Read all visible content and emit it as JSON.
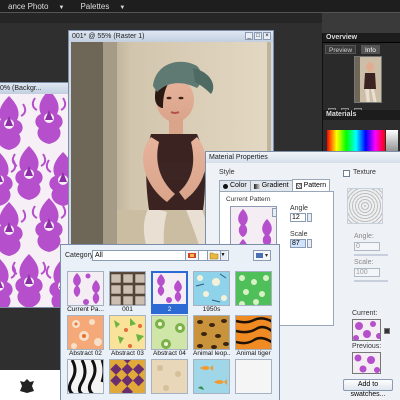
{
  "menubar": {
    "item1": "ance Photo",
    "item2": "Palettes"
  },
  "windows": {
    "damask_title": "0% (Backgr...",
    "photo_title": "001* @ 55% (Raster 1)"
  },
  "overview": {
    "title": "Overview",
    "tab_preview": "Preview",
    "tab_info": "Info"
  },
  "materials": {
    "title": "Materials"
  },
  "material_properties": {
    "title": "Material Properties",
    "style_label": "Style",
    "tabs": [
      {
        "label": "Color"
      },
      {
        "label": "Gradient"
      },
      {
        "label": "Pattern"
      }
    ],
    "texture_label": "Texture",
    "current_pattern_label": "Current Pattern",
    "angle_label": "Angle",
    "angle_value": "12",
    "scale_label": "Scale",
    "scale_value": "87",
    "texture_angle_label": "Angle:",
    "texture_angle_value": "0",
    "texture_scale_label": "Scale:",
    "texture_scale_value": "100",
    "current_label": "Current:",
    "previous_label": "Previous:",
    "add_swatches_label": "Add to swatches..."
  },
  "picker": {
    "category_label": "Category:",
    "category_value": "All",
    "items": [
      {
        "label": "Current Pa...",
        "pattern": "damask"
      },
      {
        "label": "001",
        "pattern": "keys"
      },
      {
        "label": "2",
        "pattern": "damask-selected"
      },
      {
        "label": "1950s",
        "pattern": "fifties"
      },
      {
        "label": "",
        "pattern": "green-dots"
      },
      {
        "label": "Abstract 02",
        "pattern": "abstract02"
      },
      {
        "label": "Abstract 03",
        "pattern": "abstract03"
      },
      {
        "label": "Abstract 04",
        "pattern": "abstract04"
      },
      {
        "label": "Animal leop...",
        "pattern": "leopard"
      },
      {
        "label": "Animal tiger",
        "pattern": "tiger"
      },
      {
        "label": "",
        "pattern": "zebra"
      },
      {
        "label": "",
        "pattern": "checker"
      },
      {
        "label": "",
        "pattern": "beige"
      },
      {
        "label": "",
        "pattern": "fish"
      },
      {
        "label": "",
        "pattern": "blank"
      }
    ]
  },
  "colors": {
    "selection": "#2d6bd4",
    "damask_purple": "#b04fc6"
  }
}
